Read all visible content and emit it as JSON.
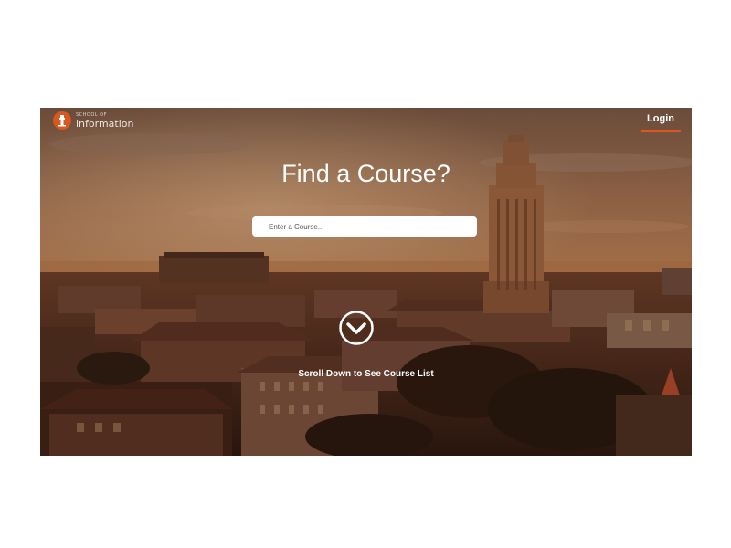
{
  "header": {
    "logo": {
      "small_text": "SCHOOL OF",
      "big_text": "information",
      "icon": "tower-logo-icon",
      "badge_color": "#d9581f"
    },
    "login_label": "Login",
    "accent_color": "#d9581f"
  },
  "hero": {
    "title": "Find a Course?",
    "search": {
      "placeholder": "Enter a Course..",
      "value": ""
    },
    "scroll_icon": "chevron-down-circle-icon",
    "scroll_label": "Scroll Down to See Course List"
  }
}
